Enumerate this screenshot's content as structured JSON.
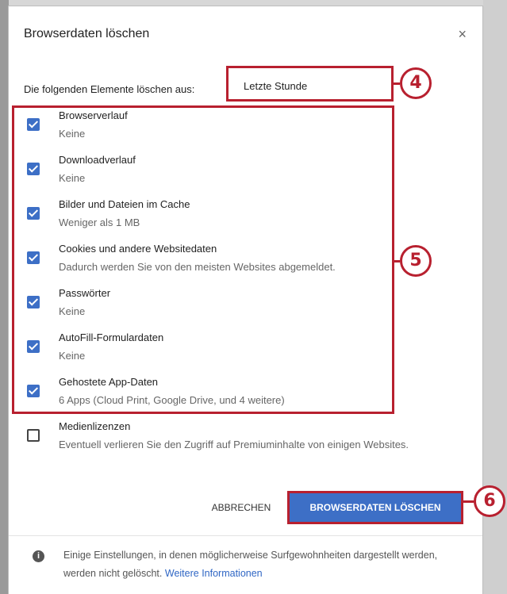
{
  "dialog": {
    "title": "Browserdaten löschen",
    "close_symbol": "×",
    "range_label": "Die folgenden Elemente löschen aus:",
    "range_value": "Letzte Stunde",
    "items": [
      {
        "label": "Browserverlauf",
        "sub": "Keine",
        "checked": true
      },
      {
        "label": "Downloadverlauf",
        "sub": "Keine",
        "checked": true
      },
      {
        "label": "Bilder und Dateien im Cache",
        "sub": "Weniger als 1 MB",
        "checked": true
      },
      {
        "label": "Cookies und andere Websitedaten",
        "sub": "Dadurch werden Sie von den meisten Websites abgemeldet.",
        "checked": true
      },
      {
        "label": "Passwörter",
        "sub": "Keine",
        "checked": true
      },
      {
        "label": "AutoFill-Formulardaten",
        "sub": "Keine",
        "checked": true
      },
      {
        "label": "Gehostete App-Daten",
        "sub": "6 Apps (Cloud Print, Google Drive, und 4 weitere)",
        "checked": true
      },
      {
        "label": "Medienlizenzen",
        "sub": "Eventuell verlieren Sie den Zugriff auf Premiuminhalte von einigen Websites.",
        "checked": false
      }
    ],
    "cancel_label": "ABBRECHEN",
    "confirm_label": "BROWSERDATEN LÖSCHEN",
    "info_icon": "i",
    "info_text": "Einige Einstellungen, in denen möglicherweise Surfgewohnheiten dargestellt werden, werden nicht gelöscht.",
    "info_link": "Weitere Informationen"
  },
  "callouts": {
    "time_range": "4",
    "checkbox_list": "5",
    "confirm_button": "6"
  },
  "colors": {
    "accent": "#3d6fc6",
    "callout_red": "#b8202f",
    "link": "#2f66c4"
  }
}
